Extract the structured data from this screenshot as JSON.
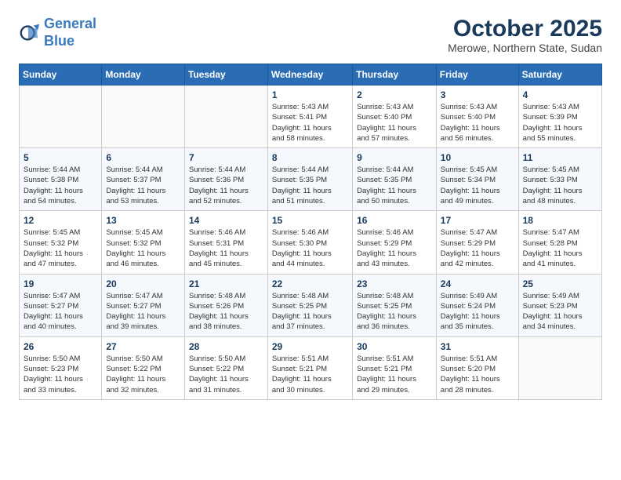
{
  "header": {
    "logo_line1": "General",
    "logo_line2": "Blue",
    "month": "October 2025",
    "location": "Merowe, Northern State, Sudan"
  },
  "days_of_week": [
    "Sunday",
    "Monday",
    "Tuesday",
    "Wednesday",
    "Thursday",
    "Friday",
    "Saturday"
  ],
  "weeks": [
    [
      {
        "day": "",
        "info": ""
      },
      {
        "day": "",
        "info": ""
      },
      {
        "day": "",
        "info": ""
      },
      {
        "day": "1",
        "info": "Sunrise: 5:43 AM\nSunset: 5:41 PM\nDaylight: 11 hours\nand 58 minutes."
      },
      {
        "day": "2",
        "info": "Sunrise: 5:43 AM\nSunset: 5:40 PM\nDaylight: 11 hours\nand 57 minutes."
      },
      {
        "day": "3",
        "info": "Sunrise: 5:43 AM\nSunset: 5:40 PM\nDaylight: 11 hours\nand 56 minutes."
      },
      {
        "day": "4",
        "info": "Sunrise: 5:43 AM\nSunset: 5:39 PM\nDaylight: 11 hours\nand 55 minutes."
      }
    ],
    [
      {
        "day": "5",
        "info": "Sunrise: 5:44 AM\nSunset: 5:38 PM\nDaylight: 11 hours\nand 54 minutes."
      },
      {
        "day": "6",
        "info": "Sunrise: 5:44 AM\nSunset: 5:37 PM\nDaylight: 11 hours\nand 53 minutes."
      },
      {
        "day": "7",
        "info": "Sunrise: 5:44 AM\nSunset: 5:36 PM\nDaylight: 11 hours\nand 52 minutes."
      },
      {
        "day": "8",
        "info": "Sunrise: 5:44 AM\nSunset: 5:35 PM\nDaylight: 11 hours\nand 51 minutes."
      },
      {
        "day": "9",
        "info": "Sunrise: 5:44 AM\nSunset: 5:35 PM\nDaylight: 11 hours\nand 50 minutes."
      },
      {
        "day": "10",
        "info": "Sunrise: 5:45 AM\nSunset: 5:34 PM\nDaylight: 11 hours\nand 49 minutes."
      },
      {
        "day": "11",
        "info": "Sunrise: 5:45 AM\nSunset: 5:33 PM\nDaylight: 11 hours\nand 48 minutes."
      }
    ],
    [
      {
        "day": "12",
        "info": "Sunrise: 5:45 AM\nSunset: 5:32 PM\nDaylight: 11 hours\nand 47 minutes."
      },
      {
        "day": "13",
        "info": "Sunrise: 5:45 AM\nSunset: 5:32 PM\nDaylight: 11 hours\nand 46 minutes."
      },
      {
        "day": "14",
        "info": "Sunrise: 5:46 AM\nSunset: 5:31 PM\nDaylight: 11 hours\nand 45 minutes."
      },
      {
        "day": "15",
        "info": "Sunrise: 5:46 AM\nSunset: 5:30 PM\nDaylight: 11 hours\nand 44 minutes."
      },
      {
        "day": "16",
        "info": "Sunrise: 5:46 AM\nSunset: 5:29 PM\nDaylight: 11 hours\nand 43 minutes."
      },
      {
        "day": "17",
        "info": "Sunrise: 5:47 AM\nSunset: 5:29 PM\nDaylight: 11 hours\nand 42 minutes."
      },
      {
        "day": "18",
        "info": "Sunrise: 5:47 AM\nSunset: 5:28 PM\nDaylight: 11 hours\nand 41 minutes."
      }
    ],
    [
      {
        "day": "19",
        "info": "Sunrise: 5:47 AM\nSunset: 5:27 PM\nDaylight: 11 hours\nand 40 minutes."
      },
      {
        "day": "20",
        "info": "Sunrise: 5:47 AM\nSunset: 5:27 PM\nDaylight: 11 hours\nand 39 minutes."
      },
      {
        "day": "21",
        "info": "Sunrise: 5:48 AM\nSunset: 5:26 PM\nDaylight: 11 hours\nand 38 minutes."
      },
      {
        "day": "22",
        "info": "Sunrise: 5:48 AM\nSunset: 5:25 PM\nDaylight: 11 hours\nand 37 minutes."
      },
      {
        "day": "23",
        "info": "Sunrise: 5:48 AM\nSunset: 5:25 PM\nDaylight: 11 hours\nand 36 minutes."
      },
      {
        "day": "24",
        "info": "Sunrise: 5:49 AM\nSunset: 5:24 PM\nDaylight: 11 hours\nand 35 minutes."
      },
      {
        "day": "25",
        "info": "Sunrise: 5:49 AM\nSunset: 5:23 PM\nDaylight: 11 hours\nand 34 minutes."
      }
    ],
    [
      {
        "day": "26",
        "info": "Sunrise: 5:50 AM\nSunset: 5:23 PM\nDaylight: 11 hours\nand 33 minutes."
      },
      {
        "day": "27",
        "info": "Sunrise: 5:50 AM\nSunset: 5:22 PM\nDaylight: 11 hours\nand 32 minutes."
      },
      {
        "day": "28",
        "info": "Sunrise: 5:50 AM\nSunset: 5:22 PM\nDaylight: 11 hours\nand 31 minutes."
      },
      {
        "day": "29",
        "info": "Sunrise: 5:51 AM\nSunset: 5:21 PM\nDaylight: 11 hours\nand 30 minutes."
      },
      {
        "day": "30",
        "info": "Sunrise: 5:51 AM\nSunset: 5:21 PM\nDaylight: 11 hours\nand 29 minutes."
      },
      {
        "day": "31",
        "info": "Sunrise: 5:51 AM\nSunset: 5:20 PM\nDaylight: 11 hours\nand 28 minutes."
      },
      {
        "day": "",
        "info": ""
      }
    ]
  ]
}
